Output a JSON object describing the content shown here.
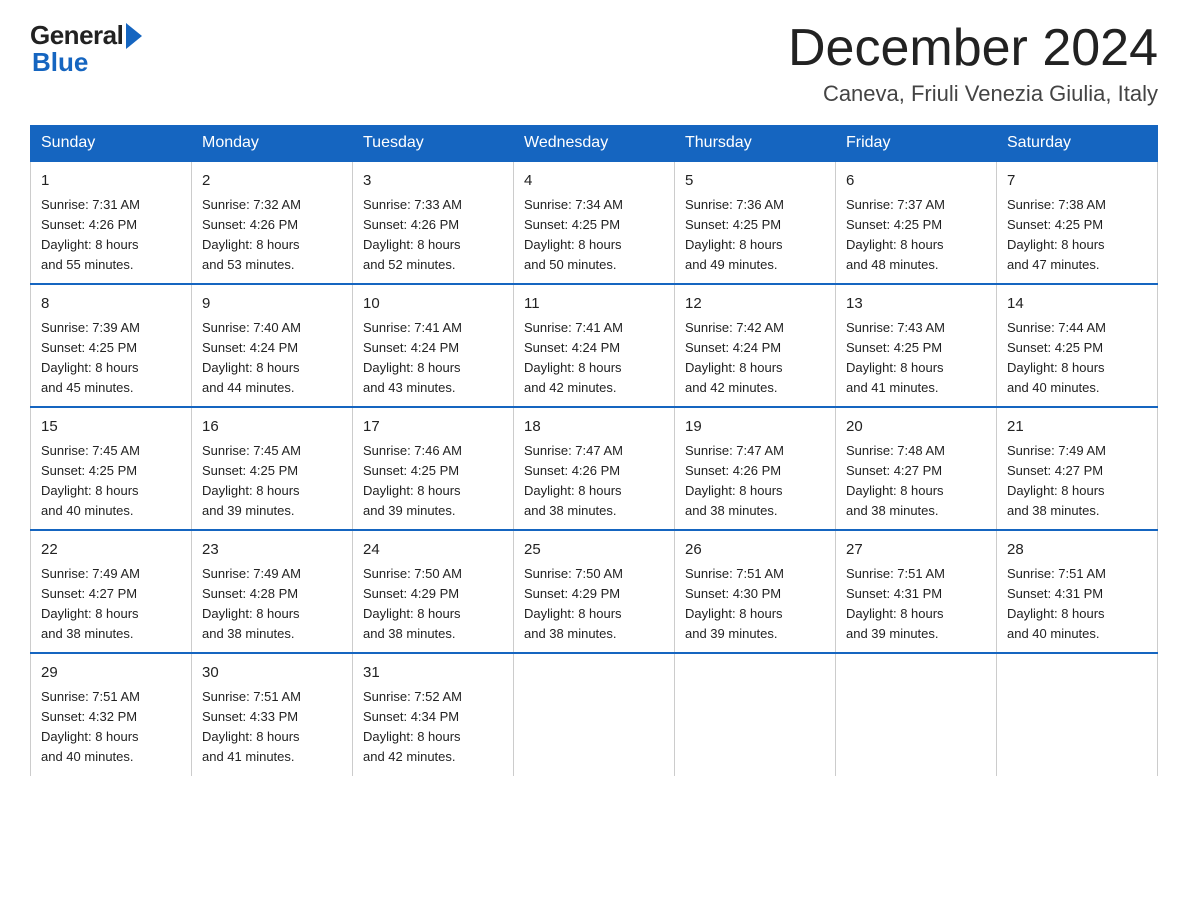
{
  "logo": {
    "general": "General",
    "blue": "Blue"
  },
  "title": "December 2024",
  "subtitle": "Caneva, Friuli Venezia Giulia, Italy",
  "days_of_week": [
    "Sunday",
    "Monday",
    "Tuesday",
    "Wednesday",
    "Thursday",
    "Friday",
    "Saturday"
  ],
  "weeks": [
    [
      {
        "num": "1",
        "sunrise": "7:31 AM",
        "sunset": "4:26 PM",
        "daylight": "8 hours and 55 minutes."
      },
      {
        "num": "2",
        "sunrise": "7:32 AM",
        "sunset": "4:26 PM",
        "daylight": "8 hours and 53 minutes."
      },
      {
        "num": "3",
        "sunrise": "7:33 AM",
        "sunset": "4:26 PM",
        "daylight": "8 hours and 52 minutes."
      },
      {
        "num": "4",
        "sunrise": "7:34 AM",
        "sunset": "4:25 PM",
        "daylight": "8 hours and 50 minutes."
      },
      {
        "num": "5",
        "sunrise": "7:36 AM",
        "sunset": "4:25 PM",
        "daylight": "8 hours and 49 minutes."
      },
      {
        "num": "6",
        "sunrise": "7:37 AM",
        "sunset": "4:25 PM",
        "daylight": "8 hours and 48 minutes."
      },
      {
        "num": "7",
        "sunrise": "7:38 AM",
        "sunset": "4:25 PM",
        "daylight": "8 hours and 47 minutes."
      }
    ],
    [
      {
        "num": "8",
        "sunrise": "7:39 AM",
        "sunset": "4:25 PM",
        "daylight": "8 hours and 45 minutes."
      },
      {
        "num": "9",
        "sunrise": "7:40 AM",
        "sunset": "4:24 PM",
        "daylight": "8 hours and 44 minutes."
      },
      {
        "num": "10",
        "sunrise": "7:41 AM",
        "sunset": "4:24 PM",
        "daylight": "8 hours and 43 minutes."
      },
      {
        "num": "11",
        "sunrise": "7:41 AM",
        "sunset": "4:24 PM",
        "daylight": "8 hours and 42 minutes."
      },
      {
        "num": "12",
        "sunrise": "7:42 AM",
        "sunset": "4:24 PM",
        "daylight": "8 hours and 42 minutes."
      },
      {
        "num": "13",
        "sunrise": "7:43 AM",
        "sunset": "4:25 PM",
        "daylight": "8 hours and 41 minutes."
      },
      {
        "num": "14",
        "sunrise": "7:44 AM",
        "sunset": "4:25 PM",
        "daylight": "8 hours and 40 minutes."
      }
    ],
    [
      {
        "num": "15",
        "sunrise": "7:45 AM",
        "sunset": "4:25 PM",
        "daylight": "8 hours and 40 minutes."
      },
      {
        "num": "16",
        "sunrise": "7:45 AM",
        "sunset": "4:25 PM",
        "daylight": "8 hours and 39 minutes."
      },
      {
        "num": "17",
        "sunrise": "7:46 AM",
        "sunset": "4:25 PM",
        "daylight": "8 hours and 39 minutes."
      },
      {
        "num": "18",
        "sunrise": "7:47 AM",
        "sunset": "4:26 PM",
        "daylight": "8 hours and 38 minutes."
      },
      {
        "num": "19",
        "sunrise": "7:47 AM",
        "sunset": "4:26 PM",
        "daylight": "8 hours and 38 minutes."
      },
      {
        "num": "20",
        "sunrise": "7:48 AM",
        "sunset": "4:27 PM",
        "daylight": "8 hours and 38 minutes."
      },
      {
        "num": "21",
        "sunrise": "7:49 AM",
        "sunset": "4:27 PM",
        "daylight": "8 hours and 38 minutes."
      }
    ],
    [
      {
        "num": "22",
        "sunrise": "7:49 AM",
        "sunset": "4:27 PM",
        "daylight": "8 hours and 38 minutes."
      },
      {
        "num": "23",
        "sunrise": "7:49 AM",
        "sunset": "4:28 PM",
        "daylight": "8 hours and 38 minutes."
      },
      {
        "num": "24",
        "sunrise": "7:50 AM",
        "sunset": "4:29 PM",
        "daylight": "8 hours and 38 minutes."
      },
      {
        "num": "25",
        "sunrise": "7:50 AM",
        "sunset": "4:29 PM",
        "daylight": "8 hours and 38 minutes."
      },
      {
        "num": "26",
        "sunrise": "7:51 AM",
        "sunset": "4:30 PM",
        "daylight": "8 hours and 39 minutes."
      },
      {
        "num": "27",
        "sunrise": "7:51 AM",
        "sunset": "4:31 PM",
        "daylight": "8 hours and 39 minutes."
      },
      {
        "num": "28",
        "sunrise": "7:51 AM",
        "sunset": "4:31 PM",
        "daylight": "8 hours and 40 minutes."
      }
    ],
    [
      {
        "num": "29",
        "sunrise": "7:51 AM",
        "sunset": "4:32 PM",
        "daylight": "8 hours and 40 minutes."
      },
      {
        "num": "30",
        "sunrise": "7:51 AM",
        "sunset": "4:33 PM",
        "daylight": "8 hours and 41 minutes."
      },
      {
        "num": "31",
        "sunrise": "7:52 AM",
        "sunset": "4:34 PM",
        "daylight": "8 hours and 42 minutes."
      },
      null,
      null,
      null,
      null
    ]
  ],
  "labels": {
    "sunrise": "Sunrise:",
    "sunset": "Sunset:",
    "daylight": "Daylight:"
  }
}
